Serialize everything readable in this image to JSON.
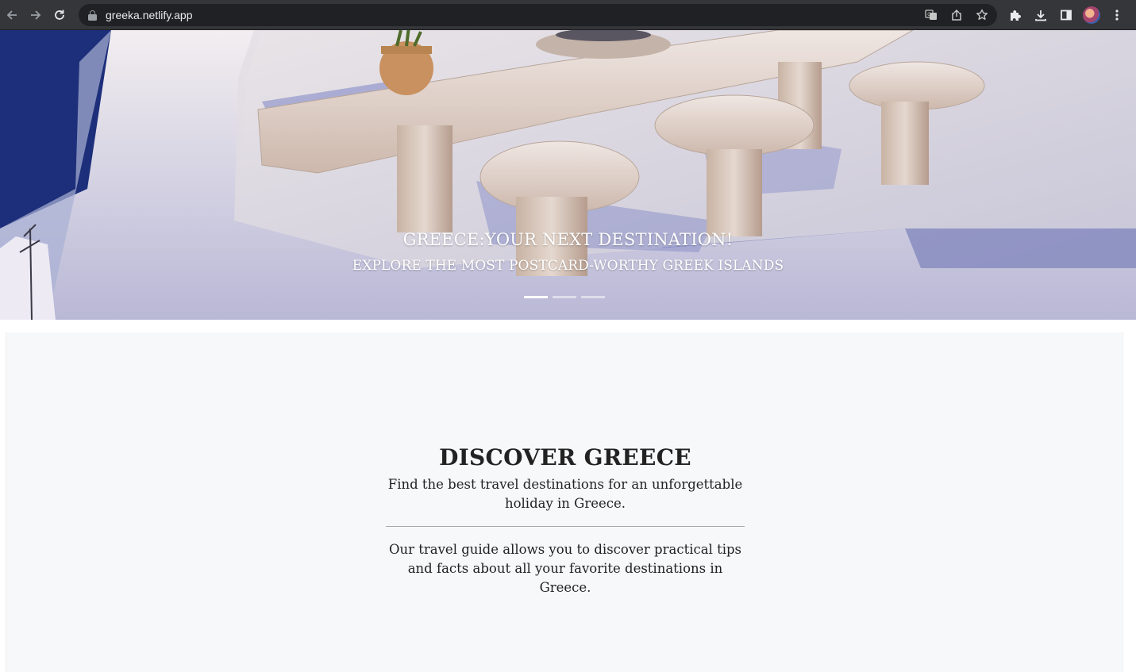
{
  "browser": {
    "url": "greeka.netlify.app",
    "icons": {
      "back": "back-arrow-icon",
      "forward": "forward-arrow-icon",
      "reload": "reload-icon",
      "lock": "lock-icon",
      "translate": "translate-icon",
      "share": "share-icon",
      "bookmark": "star-icon",
      "extensions": "puzzle-icon",
      "download": "download-icon",
      "side_panel": "side-panel-icon",
      "profile": "avatar",
      "menu": "kebab-menu-icon"
    }
  },
  "hero": {
    "title": "GREECE:YOUR NEXT DESTINATION!",
    "subtitle": "EXPLORE THE MOST POSTCARD-WORTHY GREEK ISLANDS",
    "slides": 3,
    "active_slide": 1
  },
  "discover": {
    "title": "DISCOVER GREECE",
    "lead": "Find the best travel destinations for an unforgettable holiday in Greece.",
    "text": "Our travel guide allows you to discover practical tips and facts about all your favorite destinations in Greece."
  }
}
